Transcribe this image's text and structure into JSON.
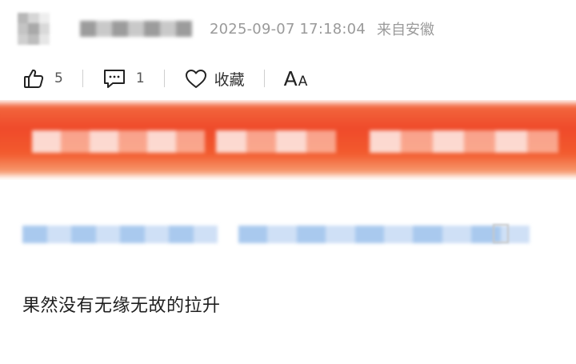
{
  "header": {
    "timestamp": "2025-09-07 17:18:04",
    "location": "来自安徽"
  },
  "actions": {
    "like_count": "5",
    "comment_count": "1",
    "favorite_label": "收藏",
    "font_size_big": "A",
    "font_size_small": "A"
  },
  "colors": {
    "banner_primary": "#ef4a2a",
    "meta_text": "#9a9a9a",
    "link_blur": "#a9c9ee"
  },
  "icons": {
    "like": "thumbs-up-icon",
    "comment": "comment-icon",
    "favorite": "heart-icon"
  },
  "comment": {
    "text": "果然没有无缘无故的拉升"
  }
}
